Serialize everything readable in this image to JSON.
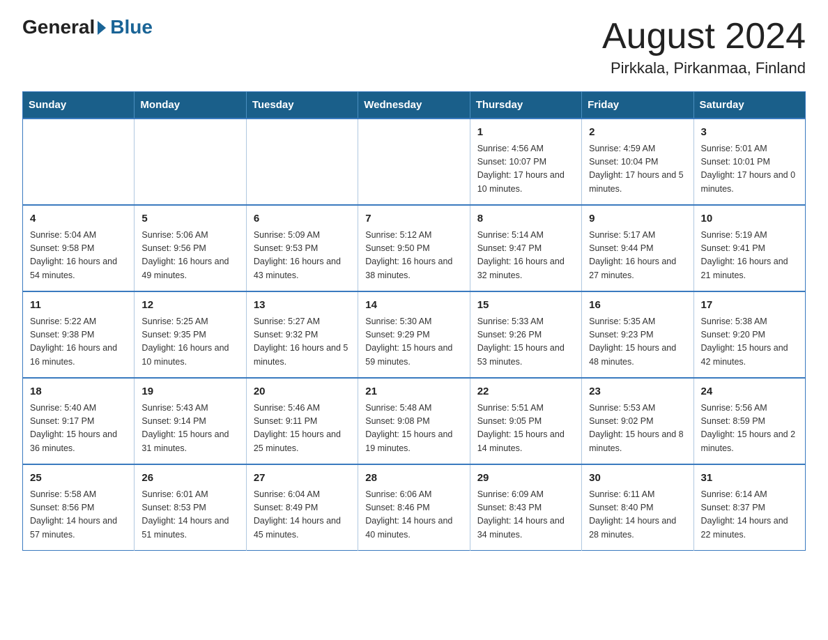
{
  "header": {
    "logo_general": "General",
    "logo_blue": "Blue",
    "title": "August 2024",
    "subtitle": "Pirkkala, Pirkanmaa, Finland"
  },
  "weekdays": [
    "Sunday",
    "Monday",
    "Tuesday",
    "Wednesday",
    "Thursday",
    "Friday",
    "Saturday"
  ],
  "weeks": [
    [
      {
        "day": "",
        "info": ""
      },
      {
        "day": "",
        "info": ""
      },
      {
        "day": "",
        "info": ""
      },
      {
        "day": "",
        "info": ""
      },
      {
        "day": "1",
        "info": "Sunrise: 4:56 AM\nSunset: 10:07 PM\nDaylight: 17 hours\nand 10 minutes."
      },
      {
        "day": "2",
        "info": "Sunrise: 4:59 AM\nSunset: 10:04 PM\nDaylight: 17 hours\nand 5 minutes."
      },
      {
        "day": "3",
        "info": "Sunrise: 5:01 AM\nSunset: 10:01 PM\nDaylight: 17 hours\nand 0 minutes."
      }
    ],
    [
      {
        "day": "4",
        "info": "Sunrise: 5:04 AM\nSunset: 9:58 PM\nDaylight: 16 hours\nand 54 minutes."
      },
      {
        "day": "5",
        "info": "Sunrise: 5:06 AM\nSunset: 9:56 PM\nDaylight: 16 hours\nand 49 minutes."
      },
      {
        "day": "6",
        "info": "Sunrise: 5:09 AM\nSunset: 9:53 PM\nDaylight: 16 hours\nand 43 minutes."
      },
      {
        "day": "7",
        "info": "Sunrise: 5:12 AM\nSunset: 9:50 PM\nDaylight: 16 hours\nand 38 minutes."
      },
      {
        "day": "8",
        "info": "Sunrise: 5:14 AM\nSunset: 9:47 PM\nDaylight: 16 hours\nand 32 minutes."
      },
      {
        "day": "9",
        "info": "Sunrise: 5:17 AM\nSunset: 9:44 PM\nDaylight: 16 hours\nand 27 minutes."
      },
      {
        "day": "10",
        "info": "Sunrise: 5:19 AM\nSunset: 9:41 PM\nDaylight: 16 hours\nand 21 minutes."
      }
    ],
    [
      {
        "day": "11",
        "info": "Sunrise: 5:22 AM\nSunset: 9:38 PM\nDaylight: 16 hours\nand 16 minutes."
      },
      {
        "day": "12",
        "info": "Sunrise: 5:25 AM\nSunset: 9:35 PM\nDaylight: 16 hours\nand 10 minutes."
      },
      {
        "day": "13",
        "info": "Sunrise: 5:27 AM\nSunset: 9:32 PM\nDaylight: 16 hours\nand 5 minutes."
      },
      {
        "day": "14",
        "info": "Sunrise: 5:30 AM\nSunset: 9:29 PM\nDaylight: 15 hours\nand 59 minutes."
      },
      {
        "day": "15",
        "info": "Sunrise: 5:33 AM\nSunset: 9:26 PM\nDaylight: 15 hours\nand 53 minutes."
      },
      {
        "day": "16",
        "info": "Sunrise: 5:35 AM\nSunset: 9:23 PM\nDaylight: 15 hours\nand 48 minutes."
      },
      {
        "day": "17",
        "info": "Sunrise: 5:38 AM\nSunset: 9:20 PM\nDaylight: 15 hours\nand 42 minutes."
      }
    ],
    [
      {
        "day": "18",
        "info": "Sunrise: 5:40 AM\nSunset: 9:17 PM\nDaylight: 15 hours\nand 36 minutes."
      },
      {
        "day": "19",
        "info": "Sunrise: 5:43 AM\nSunset: 9:14 PM\nDaylight: 15 hours\nand 31 minutes."
      },
      {
        "day": "20",
        "info": "Sunrise: 5:46 AM\nSunset: 9:11 PM\nDaylight: 15 hours\nand 25 minutes."
      },
      {
        "day": "21",
        "info": "Sunrise: 5:48 AM\nSunset: 9:08 PM\nDaylight: 15 hours\nand 19 minutes."
      },
      {
        "day": "22",
        "info": "Sunrise: 5:51 AM\nSunset: 9:05 PM\nDaylight: 15 hours\nand 14 minutes."
      },
      {
        "day": "23",
        "info": "Sunrise: 5:53 AM\nSunset: 9:02 PM\nDaylight: 15 hours\nand 8 minutes."
      },
      {
        "day": "24",
        "info": "Sunrise: 5:56 AM\nSunset: 8:59 PM\nDaylight: 15 hours\nand 2 minutes."
      }
    ],
    [
      {
        "day": "25",
        "info": "Sunrise: 5:58 AM\nSunset: 8:56 PM\nDaylight: 14 hours\nand 57 minutes."
      },
      {
        "day": "26",
        "info": "Sunrise: 6:01 AM\nSunset: 8:53 PM\nDaylight: 14 hours\nand 51 minutes."
      },
      {
        "day": "27",
        "info": "Sunrise: 6:04 AM\nSunset: 8:49 PM\nDaylight: 14 hours\nand 45 minutes."
      },
      {
        "day": "28",
        "info": "Sunrise: 6:06 AM\nSunset: 8:46 PM\nDaylight: 14 hours\nand 40 minutes."
      },
      {
        "day": "29",
        "info": "Sunrise: 6:09 AM\nSunset: 8:43 PM\nDaylight: 14 hours\nand 34 minutes."
      },
      {
        "day": "30",
        "info": "Sunrise: 6:11 AM\nSunset: 8:40 PM\nDaylight: 14 hours\nand 28 minutes."
      },
      {
        "day": "31",
        "info": "Sunrise: 6:14 AM\nSunset: 8:37 PM\nDaylight: 14 hours\nand 22 minutes."
      }
    ]
  ]
}
